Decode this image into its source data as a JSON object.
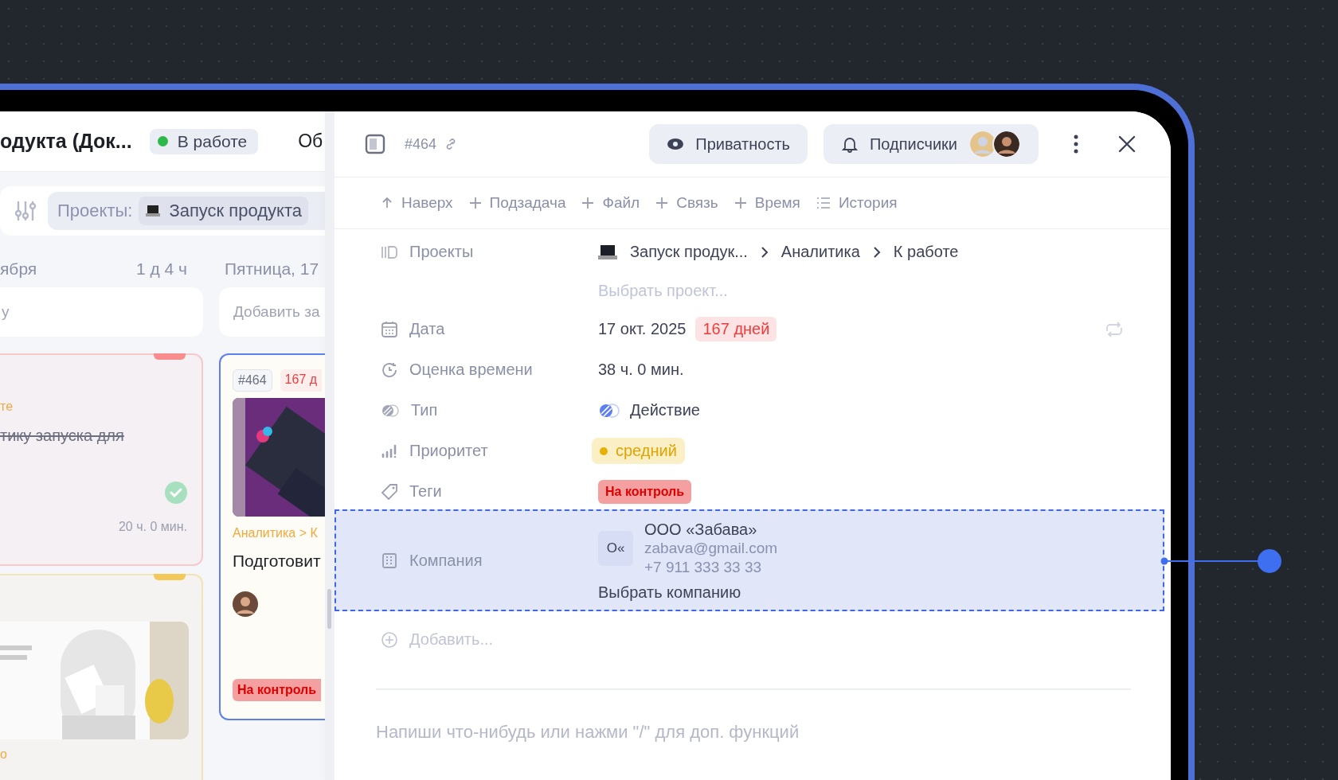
{
  "board": {
    "title": "одукта (Док...",
    "status": "В работе",
    "tab_cut": "Об",
    "filter": {
      "label": "Проекты:",
      "chip": "Запуск продукта"
    },
    "columns": [
      {
        "title": "ября",
        "total": "1 д 4 ч",
        "add_placeholder": "у",
        "cards": [
          {
            "kind": "task",
            "color": "#f98c8c",
            "path": "те",
            "title": "тику запуска для",
            "done": true,
            "estimate": "20 ч. 0 мин.",
            "selected": false
          },
          {
            "kind": "picture",
            "color": "#f3c95a",
            "path": "о",
            "selected": false
          }
        ]
      },
      {
        "title": "Пятница, 17",
        "add_placeholder": "Добавить за",
        "cards": [
          {
            "kind": "detailed",
            "id": "#464",
            "due": "167 д",
            "path": "Аналитика > К",
            "title": "Подготовит",
            "tag": "На контроль",
            "selected": true
          }
        ]
      }
    ]
  },
  "drawer": {
    "id": "#464",
    "buttons": [
      {
        "kind": "privacy",
        "label": "Приватность"
      },
      {
        "kind": "subscribers",
        "label": "Подписчики",
        "avatars": [
          {
            "kind": "light"
          },
          {
            "kind": "dark"
          }
        ]
      }
    ],
    "actions": [
      {
        "kind": "up",
        "label": "Наверх"
      },
      {
        "kind": "add",
        "label": "Подзадача"
      },
      {
        "kind": "add",
        "label": "Файл"
      },
      {
        "kind": "add",
        "label": "Связь"
      },
      {
        "kind": "add",
        "label": "Время"
      },
      {
        "kind": "list",
        "label": "История"
      }
    ],
    "fields": [
      {
        "kind": "projects",
        "label": "Проекты",
        "path": [
          "Запуск продук...",
          "Аналитика",
          "К работе"
        ],
        "placeholder": "Выбрать проект..."
      },
      {
        "kind": "date",
        "label": "Дата",
        "value": "17 окт. 2025",
        "badge": "167 дней"
      },
      {
        "kind": "estimate",
        "label": "Оценка времени",
        "value": "38 ч. 0 мин."
      },
      {
        "kind": "type",
        "label": "Тип",
        "value": "Действие"
      },
      {
        "kind": "priority",
        "label": "Приоритет",
        "value": "средний"
      },
      {
        "kind": "tags",
        "label": "Теги",
        "tags": [
          "На контроль"
        ]
      },
      {
        "kind": "company",
        "label": "Компания",
        "initials": "О«",
        "name": "ООО «Забава»",
        "email": "zabava@gmail.com",
        "phone": "+7 911 333 33 33",
        "action": "Выбрать компанию",
        "highlighted": true
      }
    ],
    "add_field": "Добавить...",
    "editor": {
      "placeholder": "Напиши что-нибудь или нажми \"/\" для доп. функций"
    }
  }
}
